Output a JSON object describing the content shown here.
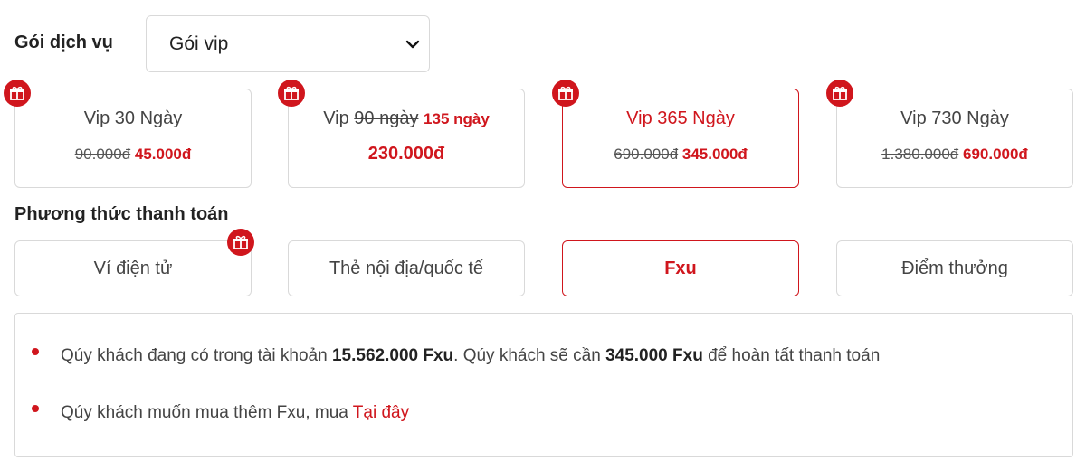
{
  "service": {
    "label": "Gói dịch vụ",
    "selected": "Gói vip"
  },
  "packages": [
    {
      "title": "Vip 30 Ngày",
      "old_price": "90.000đ",
      "new_price": "45.000đ",
      "selected": false,
      "gift": true
    },
    {
      "title_prefix": "Vip",
      "title_old": "90 ngày",
      "title_new": "135 ngày",
      "price": "230.000đ",
      "selected": false,
      "gift": true
    },
    {
      "title": "Vip 365 Ngày",
      "old_price": "690.000đ",
      "new_price": "345.000đ",
      "selected": true,
      "gift": true
    },
    {
      "title": "Vip 730 Ngày",
      "old_price": "1.380.000đ",
      "new_price": "690.000đ",
      "selected": false,
      "gift": true
    }
  ],
  "payment": {
    "label": "Phương thức thanh toán",
    "methods": [
      {
        "label": "Ví điện tử",
        "selected": false,
        "gift": true
      },
      {
        "label": "Thẻ nội địa/quốc tế",
        "selected": false,
        "gift": false
      },
      {
        "label": "Fxu",
        "selected": true,
        "gift": false
      },
      {
        "label": "Điểm thưởng",
        "selected": false,
        "gift": false
      }
    ]
  },
  "info": {
    "line1_a": "Qúy khách đang có trong tài khoản ",
    "balance": "15.562.000 Fxu",
    "line1_b": ". Qúy khách sẽ cần ",
    "required": "345.000 Fxu",
    "line1_c": " để hoàn tất thanh toán",
    "line2_a": "Qúy khách muốn mua thêm Fxu, mua ",
    "link": "Tại đây"
  },
  "colors": {
    "accent": "#d0161d",
    "border": "#d9d9d9"
  },
  "icons": {
    "gift": "gift-icon",
    "chevron": "chevron-down-icon"
  }
}
